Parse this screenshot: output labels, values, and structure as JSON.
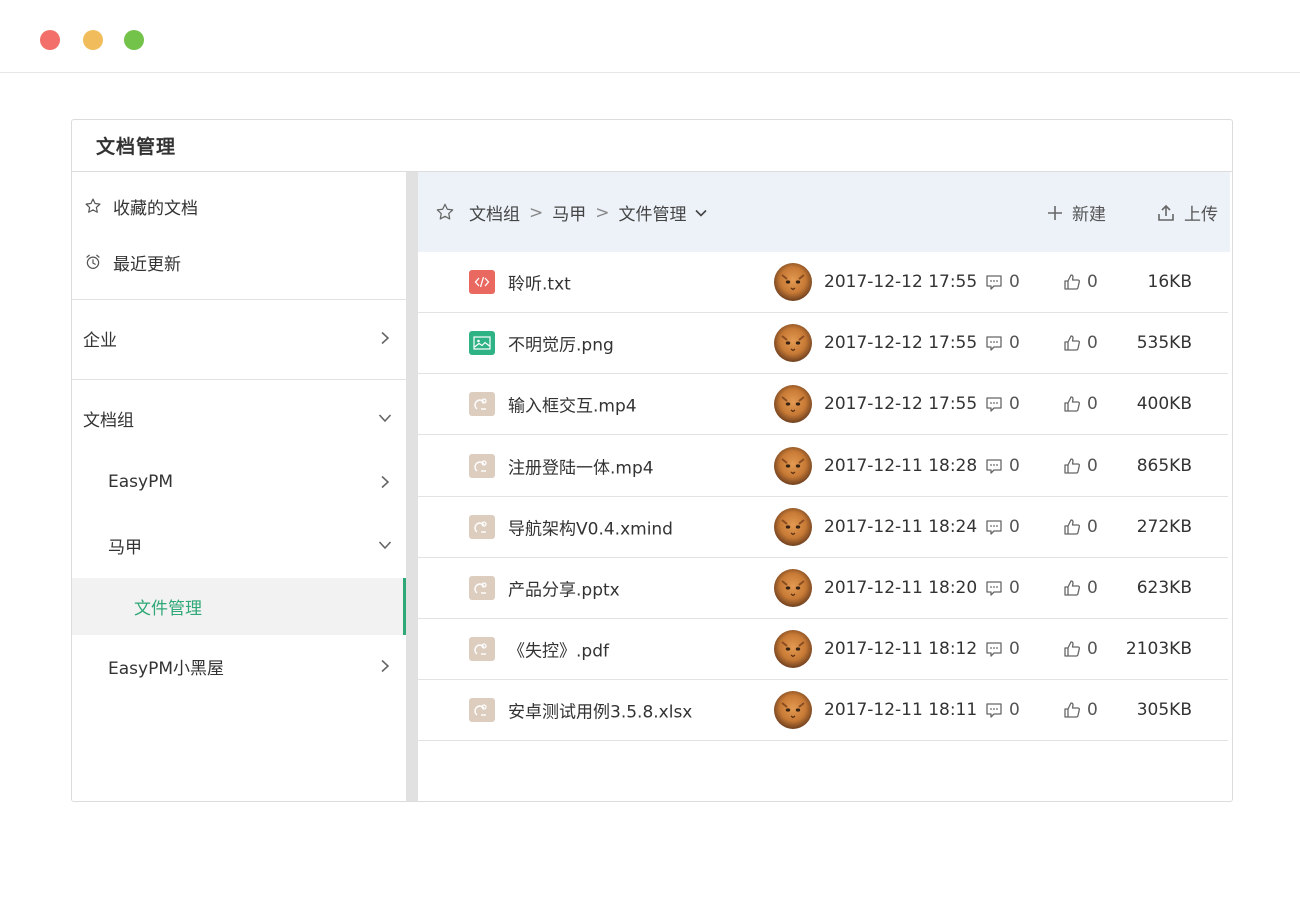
{
  "window": {
    "controls": [
      "close",
      "minimize",
      "maximize"
    ]
  },
  "panel": {
    "title": "文档管理"
  },
  "sidebar": {
    "favorites": {
      "label": "收藏的文档",
      "icon": "star-icon"
    },
    "recent": {
      "label": "最近更新",
      "icon": "alarm-clock-icon"
    },
    "enterprise": {
      "label": "企业"
    },
    "docgroup": {
      "label": "文档组"
    },
    "easypm": {
      "label": "EasyPM"
    },
    "majia": {
      "label": "马甲"
    },
    "file_mgmt": {
      "label": "文件管理"
    },
    "easypm_room": {
      "label": "EasyPM小黑屋"
    }
  },
  "toolbar": {
    "crumbs": [
      "文档组",
      "马甲",
      "文件管理"
    ],
    "sep": ">",
    "new_label": "新建",
    "upload_label": "上传"
  },
  "files": [
    {
      "name": "聆听.txt",
      "type": "code",
      "date": "2017-12-12 17:55",
      "comments": "0",
      "likes": "0",
      "size": "16KB"
    },
    {
      "name": "不明觉厉.png",
      "type": "image",
      "date": "2017-12-12 17:55",
      "comments": "0",
      "likes": "0",
      "size": "535KB"
    },
    {
      "name": "输入框交互.mp4",
      "type": "generic",
      "date": "2017-12-12 17:55",
      "comments": "0",
      "likes": "0",
      "size": "400KB"
    },
    {
      "name": "注册登陆一体.mp4",
      "type": "generic",
      "date": "2017-12-11 18:28",
      "comments": "0",
      "likes": "0",
      "size": "865KB"
    },
    {
      "name": "导航架构V0.4.xmind",
      "type": "generic",
      "date": "2017-12-11 18:24",
      "comments": "0",
      "likes": "0",
      "size": "272KB"
    },
    {
      "name": "产品分享.pptx",
      "type": "generic",
      "date": "2017-12-11 18:20",
      "comments": "0",
      "likes": "0",
      "size": "623KB"
    },
    {
      "name": "《失控》.pdf",
      "type": "generic",
      "date": "2017-12-11 18:12",
      "comments": "0",
      "likes": "0",
      "size": "2103KB"
    },
    {
      "name": "安卓测试用例3.5.8.xlsx",
      "type": "generic",
      "date": "2017-12-11 18:11",
      "comments": "0",
      "likes": "0",
      "size": "305KB"
    }
  ],
  "colors": {
    "accent": "#2ea876",
    "toolbar_bg": "#edf2f9",
    "code_icon": "#e9685f",
    "image_icon": "#2fb384",
    "generic_icon": "#dccdbf"
  }
}
